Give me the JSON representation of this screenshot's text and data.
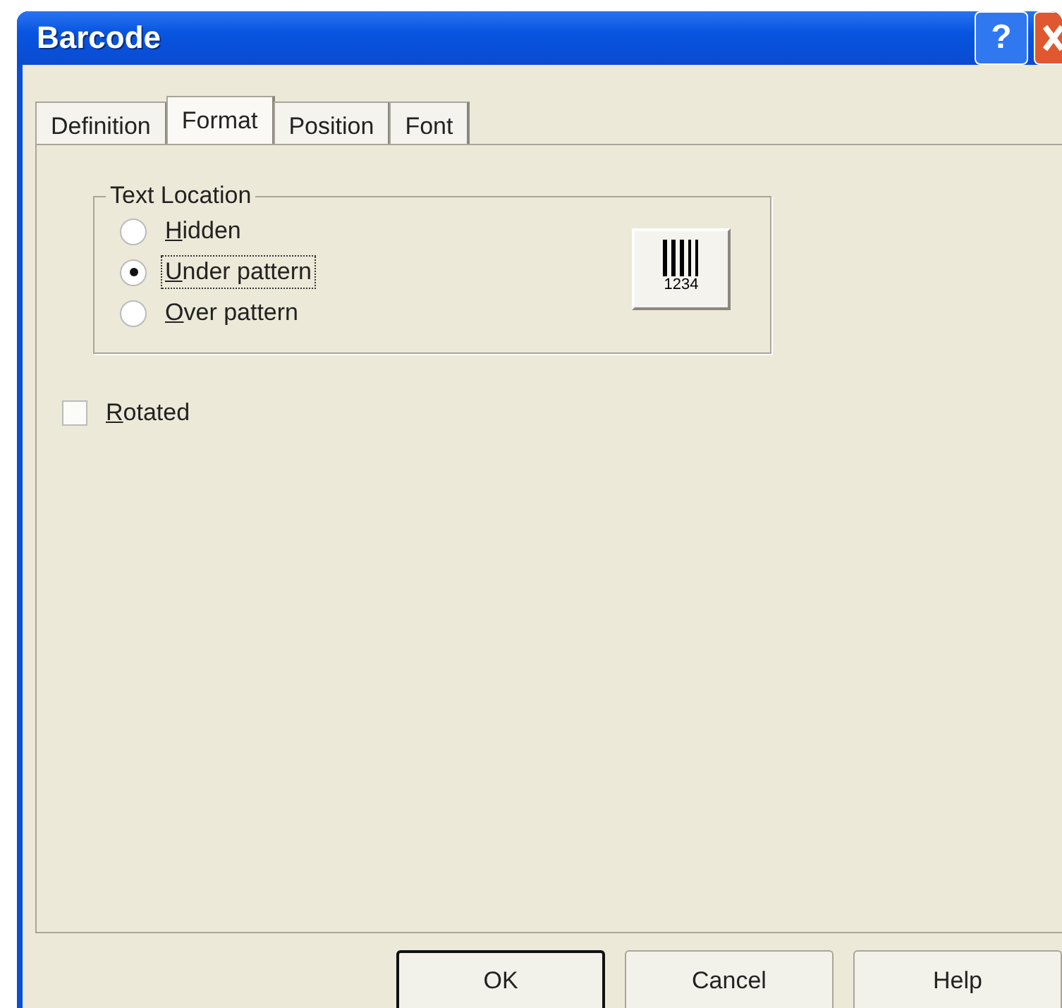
{
  "window": {
    "title": "Barcode",
    "help_button": "?"
  },
  "tabs": [
    {
      "label": "Definition",
      "selected": false
    },
    {
      "label": "Format",
      "selected": true
    },
    {
      "label": "Position",
      "selected": false
    },
    {
      "label": "Font",
      "selected": false
    }
  ],
  "text_location": {
    "title": "Text Location",
    "options": [
      {
        "label": "Hidden",
        "selected": false
      },
      {
        "label": "Under pattern",
        "selected": true
      },
      {
        "label": "Over pattern",
        "selected": false
      }
    ],
    "preview_digits": "1234"
  },
  "rotated": {
    "label": "Rotated",
    "checked": false
  },
  "buttons": [
    {
      "label": "OK",
      "default": true
    },
    {
      "label": "Cancel",
      "default": false
    },
    {
      "label": "Help",
      "default": false
    }
  ]
}
